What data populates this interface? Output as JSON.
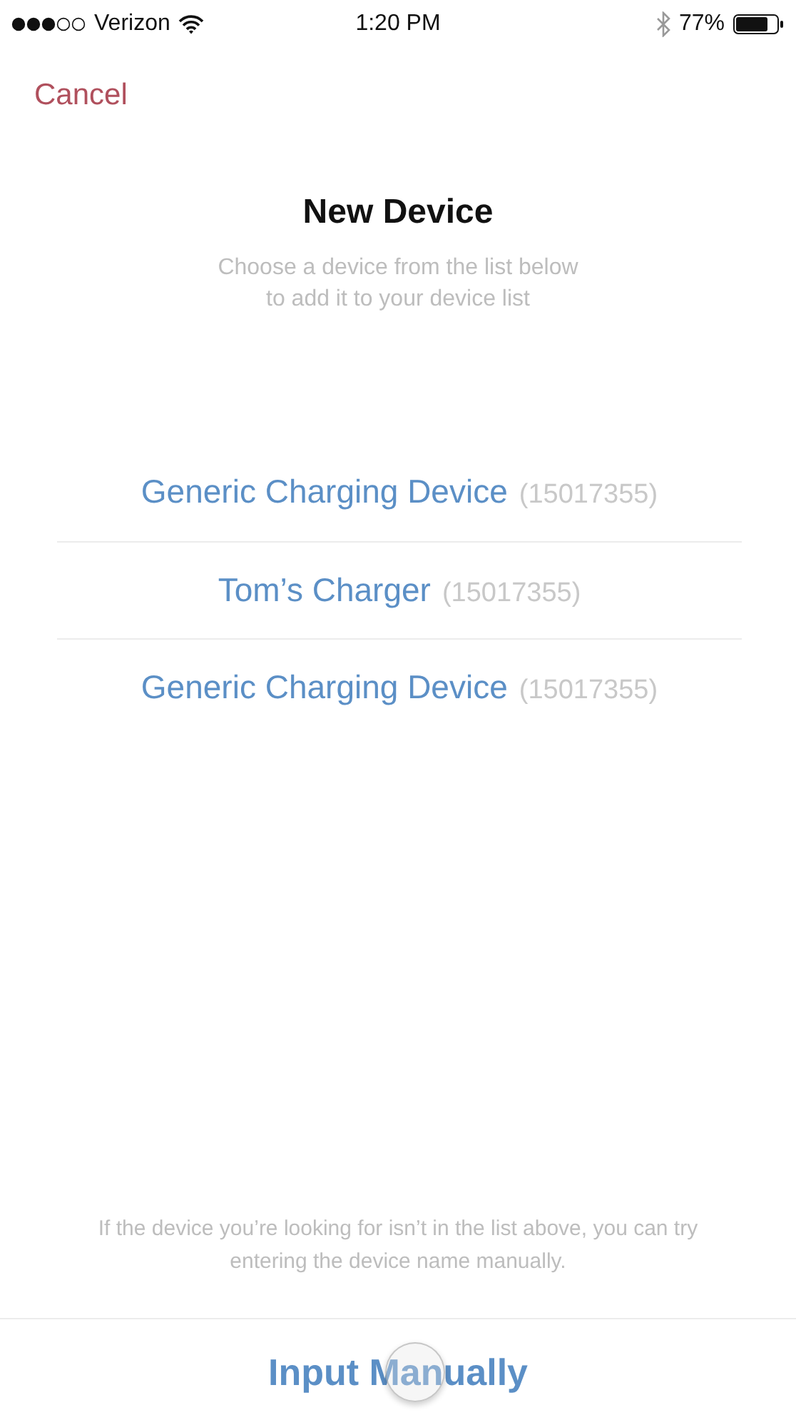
{
  "status_bar": {
    "carrier": "Verizon",
    "time": "1:20 PM",
    "battery": "77%"
  },
  "nav": {
    "cancel": "Cancel"
  },
  "title": "New Device",
  "subtitle": "Choose a device from the list below to add it to your device list",
  "devices": [
    {
      "name": "Generic Charging Device",
      "serial": "(15017355)"
    },
    {
      "name": "Tom’s Charger",
      "serial": "(15017355)"
    },
    {
      "name": "Generic Charging Device",
      "serial": "(15017355)"
    }
  ],
  "hint": "If the device you’re looking for isn’t in the list above, you can try entering the device name manually.",
  "button": "Input Manually"
}
